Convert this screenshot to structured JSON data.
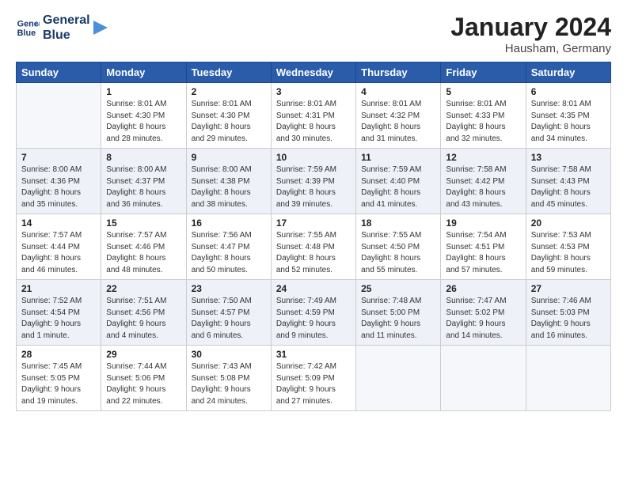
{
  "logo": {
    "line1": "General",
    "line2": "Blue"
  },
  "title": "January 2024",
  "location": "Hausham, Germany",
  "columns": [
    "Sunday",
    "Monday",
    "Tuesday",
    "Wednesday",
    "Thursday",
    "Friday",
    "Saturday"
  ],
  "weeks": [
    [
      {
        "day": "",
        "info": ""
      },
      {
        "day": "1",
        "info": "Sunrise: 8:01 AM\nSunset: 4:30 PM\nDaylight: 8 hours\nand 28 minutes."
      },
      {
        "day": "2",
        "info": "Sunrise: 8:01 AM\nSunset: 4:30 PM\nDaylight: 8 hours\nand 29 minutes."
      },
      {
        "day": "3",
        "info": "Sunrise: 8:01 AM\nSunset: 4:31 PM\nDaylight: 8 hours\nand 30 minutes."
      },
      {
        "day": "4",
        "info": "Sunrise: 8:01 AM\nSunset: 4:32 PM\nDaylight: 8 hours\nand 31 minutes."
      },
      {
        "day": "5",
        "info": "Sunrise: 8:01 AM\nSunset: 4:33 PM\nDaylight: 8 hours\nand 32 minutes."
      },
      {
        "day": "6",
        "info": "Sunrise: 8:01 AM\nSunset: 4:35 PM\nDaylight: 8 hours\nand 34 minutes."
      }
    ],
    [
      {
        "day": "7",
        "info": "Sunrise: 8:00 AM\nSunset: 4:36 PM\nDaylight: 8 hours\nand 35 minutes."
      },
      {
        "day": "8",
        "info": "Sunrise: 8:00 AM\nSunset: 4:37 PM\nDaylight: 8 hours\nand 36 minutes."
      },
      {
        "day": "9",
        "info": "Sunrise: 8:00 AM\nSunset: 4:38 PM\nDaylight: 8 hours\nand 38 minutes."
      },
      {
        "day": "10",
        "info": "Sunrise: 7:59 AM\nSunset: 4:39 PM\nDaylight: 8 hours\nand 39 minutes."
      },
      {
        "day": "11",
        "info": "Sunrise: 7:59 AM\nSunset: 4:40 PM\nDaylight: 8 hours\nand 41 minutes."
      },
      {
        "day": "12",
        "info": "Sunrise: 7:58 AM\nSunset: 4:42 PM\nDaylight: 8 hours\nand 43 minutes."
      },
      {
        "day": "13",
        "info": "Sunrise: 7:58 AM\nSunset: 4:43 PM\nDaylight: 8 hours\nand 45 minutes."
      }
    ],
    [
      {
        "day": "14",
        "info": "Sunrise: 7:57 AM\nSunset: 4:44 PM\nDaylight: 8 hours\nand 46 minutes."
      },
      {
        "day": "15",
        "info": "Sunrise: 7:57 AM\nSunset: 4:46 PM\nDaylight: 8 hours\nand 48 minutes."
      },
      {
        "day": "16",
        "info": "Sunrise: 7:56 AM\nSunset: 4:47 PM\nDaylight: 8 hours\nand 50 minutes."
      },
      {
        "day": "17",
        "info": "Sunrise: 7:55 AM\nSunset: 4:48 PM\nDaylight: 8 hours\nand 52 minutes."
      },
      {
        "day": "18",
        "info": "Sunrise: 7:55 AM\nSunset: 4:50 PM\nDaylight: 8 hours\nand 55 minutes."
      },
      {
        "day": "19",
        "info": "Sunrise: 7:54 AM\nSunset: 4:51 PM\nDaylight: 8 hours\nand 57 minutes."
      },
      {
        "day": "20",
        "info": "Sunrise: 7:53 AM\nSunset: 4:53 PM\nDaylight: 8 hours\nand 59 minutes."
      }
    ],
    [
      {
        "day": "21",
        "info": "Sunrise: 7:52 AM\nSunset: 4:54 PM\nDaylight: 9 hours\nand 1 minute."
      },
      {
        "day": "22",
        "info": "Sunrise: 7:51 AM\nSunset: 4:56 PM\nDaylight: 9 hours\nand 4 minutes."
      },
      {
        "day": "23",
        "info": "Sunrise: 7:50 AM\nSunset: 4:57 PM\nDaylight: 9 hours\nand 6 minutes."
      },
      {
        "day": "24",
        "info": "Sunrise: 7:49 AM\nSunset: 4:59 PM\nDaylight: 9 hours\nand 9 minutes."
      },
      {
        "day": "25",
        "info": "Sunrise: 7:48 AM\nSunset: 5:00 PM\nDaylight: 9 hours\nand 11 minutes."
      },
      {
        "day": "26",
        "info": "Sunrise: 7:47 AM\nSunset: 5:02 PM\nDaylight: 9 hours\nand 14 minutes."
      },
      {
        "day": "27",
        "info": "Sunrise: 7:46 AM\nSunset: 5:03 PM\nDaylight: 9 hours\nand 16 minutes."
      }
    ],
    [
      {
        "day": "28",
        "info": "Sunrise: 7:45 AM\nSunset: 5:05 PM\nDaylight: 9 hours\nand 19 minutes."
      },
      {
        "day": "29",
        "info": "Sunrise: 7:44 AM\nSunset: 5:06 PM\nDaylight: 9 hours\nand 22 minutes."
      },
      {
        "day": "30",
        "info": "Sunrise: 7:43 AM\nSunset: 5:08 PM\nDaylight: 9 hours\nand 24 minutes."
      },
      {
        "day": "31",
        "info": "Sunrise: 7:42 AM\nSunset: 5:09 PM\nDaylight: 9 hours\nand 27 minutes."
      },
      {
        "day": "",
        "info": ""
      },
      {
        "day": "",
        "info": ""
      },
      {
        "day": "",
        "info": ""
      }
    ]
  ]
}
